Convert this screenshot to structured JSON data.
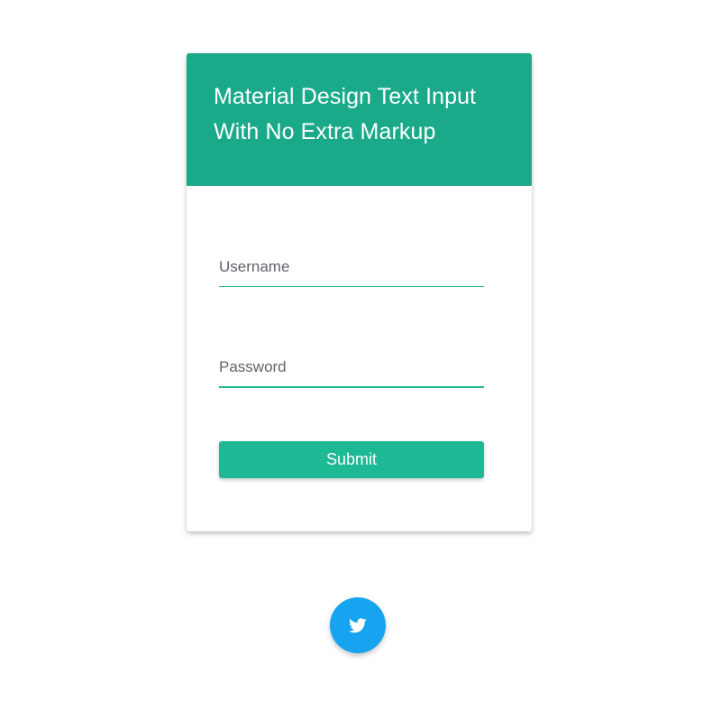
{
  "card": {
    "title": "Material Design Text Input With No Extra Markup",
    "header_color": "#1aa989"
  },
  "form": {
    "username": {
      "placeholder": "Username",
      "value": ""
    },
    "password": {
      "placeholder": "Password",
      "value": ""
    },
    "submit_label": "Submit",
    "accent_color": "#1cb994"
  },
  "social": {
    "twitter_icon": "twitter-icon",
    "twitter_color": "#16a3ef"
  }
}
